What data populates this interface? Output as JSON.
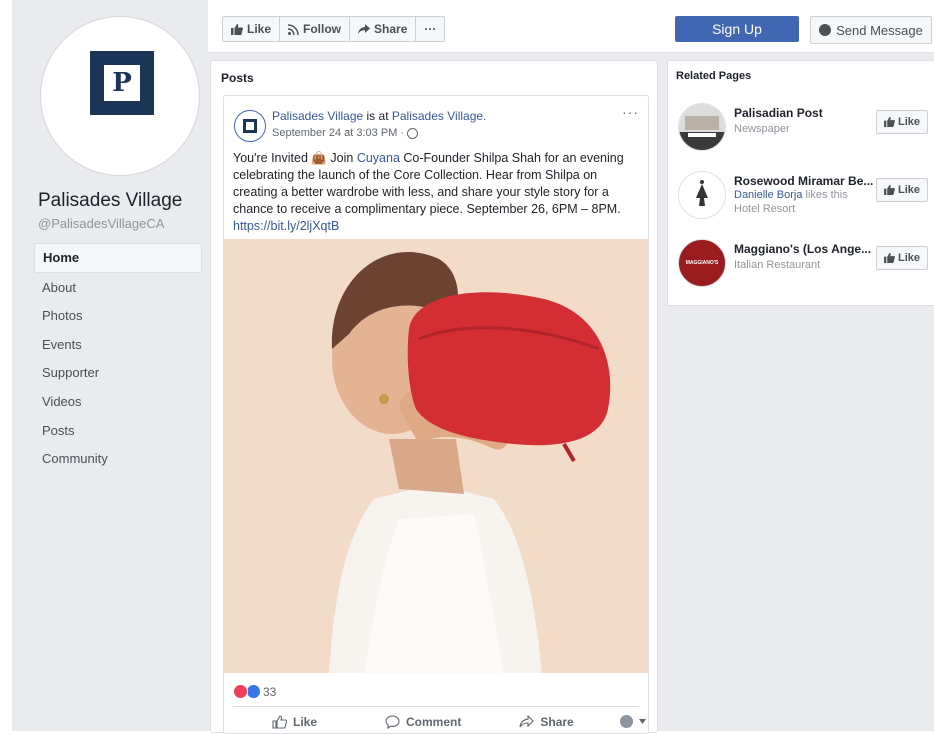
{
  "page": {
    "name": "Palisades Village",
    "handle": "@PalisadesVillageCA",
    "logo_letter": "P",
    "brand_color": "#1c3557",
    "accent_color": "#4267b2"
  },
  "nav": {
    "items": [
      "Home",
      "About",
      "Photos",
      "Events",
      "Supporter",
      "Videos",
      "Posts",
      "Community"
    ],
    "active": "Home"
  },
  "topbar": {
    "like_label": "Like",
    "follow_label": "Follow",
    "share_label": "Share",
    "more_label": "···",
    "signup_label": "Sign Up",
    "send_message_label": "Send Message"
  },
  "posts": {
    "title": "Posts",
    "post": {
      "author": "Palisades Village",
      "is_at": "is at",
      "place": "Palisades Village.",
      "date": "September 24 at 3:03 PM ·",
      "more": "···",
      "text_1": "You're Invited 👜 Join ",
      "mention": "Cuyana",
      "text_2": " Co-Founder Shilpa Shah for an evening celebrating the launch of the Core Collection. Hear from Shilpa on creating a better wardrobe with less, and share your style story for a chance to receive a complimentary piece. September 26, 6PM – 8PM.",
      "link": "https://bit.ly/2ljXqtB",
      "reaction_count": "33",
      "actions": {
        "like": "Like",
        "comment": "Comment",
        "share": "Share"
      }
    }
  },
  "related": {
    "title": "Related Pages",
    "items": [
      {
        "name": "Palisadian Post",
        "sub": "Newspaper",
        "like": "Like"
      },
      {
        "name": "Rosewood Miramar Be...",
        "friend": "Danielle Borja",
        "friend_suffix": " likes this",
        "sub": "Hotel Resort",
        "like": "Like"
      },
      {
        "name": "Maggiano's (Los Ange...",
        "sub": "Italian Restaurant",
        "like": "Like",
        "logo_text": "MAGGIANO'S"
      }
    ]
  }
}
